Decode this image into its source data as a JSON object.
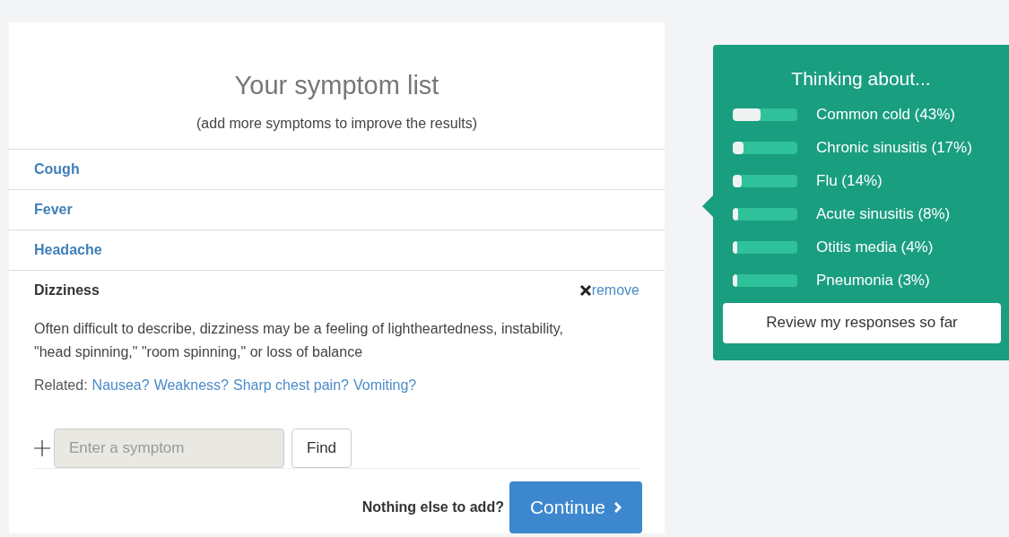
{
  "symptom_list": {
    "title": "Your symptom list",
    "subtitle": "(add more symptoms to improve the results)",
    "symptoms": [
      {
        "name": "Cough",
        "expanded": false
      },
      {
        "name": "Fever",
        "expanded": false
      },
      {
        "name": "Headache",
        "expanded": false
      },
      {
        "name": "Dizziness",
        "expanded": true,
        "remove": "remove",
        "description": "Often difficult to describe, dizziness may be a feeling of lightheartedness, instability, \"head spinning,\" \"room spinning,\" or loss of balance",
        "related_label": "Related:",
        "related": [
          "Nausea?",
          "Weakness?",
          "Sharp chest pain?",
          "Vomiting?"
        ]
      }
    ],
    "search": {
      "placeholder": "Enter a symptom",
      "button": "Find"
    },
    "footer": {
      "prompt": "Nothing else to add?",
      "button": "Continue"
    }
  },
  "thinking_panel": {
    "title": "Thinking about...",
    "conditions": [
      {
        "label": "Common cold (43%)",
        "level": 0.43
      },
      {
        "label": "Chronic sinusitis (17%)",
        "level": 0.17
      },
      {
        "label": "Flu (14%)",
        "level": 0.14
      },
      {
        "label": "Acute sinusitis (8%)",
        "level": 0.08
      },
      {
        "label": "Otitis media (4%)",
        "level": 0.04
      },
      {
        "label": "Pneumonia (3%)",
        "level": 0.03
      }
    ],
    "button": "Review my responses so far"
  }
}
